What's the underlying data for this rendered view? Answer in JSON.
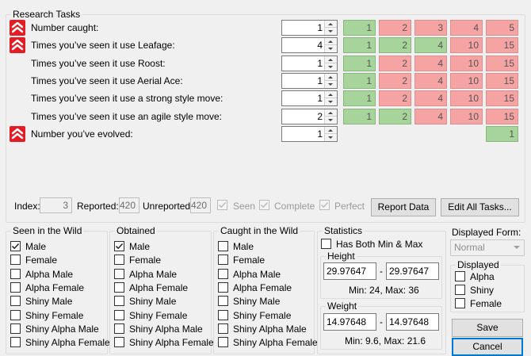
{
  "research": {
    "legend": "Research Tasks",
    "tasks": [
      {
        "label": "Number caught:",
        "value": "1",
        "priority": true,
        "thresholds": [
          {
            "v": "1",
            "c": "g"
          },
          {
            "v": "2",
            "c": "r"
          },
          {
            "v": "3",
            "c": "r"
          },
          {
            "v": "4",
            "c": "r"
          },
          {
            "v": "5",
            "c": "r"
          }
        ]
      },
      {
        "label": "Times you’ve seen it use Leafage:",
        "value": "4",
        "priority": true,
        "thresholds": [
          {
            "v": "1",
            "c": "g"
          },
          {
            "v": "2",
            "c": "g"
          },
          {
            "v": "4",
            "c": "g"
          },
          {
            "v": "10",
            "c": "r"
          },
          {
            "v": "15",
            "c": "r"
          }
        ]
      },
      {
        "label": "Times you’ve seen it use Roost:",
        "value": "1",
        "priority": false,
        "thresholds": [
          {
            "v": "1",
            "c": "g"
          },
          {
            "v": "2",
            "c": "r"
          },
          {
            "v": "4",
            "c": "r"
          },
          {
            "v": "10",
            "c": "r"
          },
          {
            "v": "15",
            "c": "r"
          }
        ]
      },
      {
        "label": "Times you’ve seen it use Aerial Ace:",
        "value": "1",
        "priority": false,
        "thresholds": [
          {
            "v": "1",
            "c": "g"
          },
          {
            "v": "2",
            "c": "r"
          },
          {
            "v": "4",
            "c": "r"
          },
          {
            "v": "10",
            "c": "r"
          },
          {
            "v": "15",
            "c": "r"
          }
        ]
      },
      {
        "label": "Times you’ve seen it use a strong style move:",
        "value": "1",
        "priority": false,
        "thresholds": [
          {
            "v": "1",
            "c": "g"
          },
          {
            "v": "2",
            "c": "r"
          },
          {
            "v": "4",
            "c": "r"
          },
          {
            "v": "10",
            "c": "r"
          },
          {
            "v": "15",
            "c": "r"
          }
        ]
      },
      {
        "label": "Times you’ve seen it use an agile style move:",
        "value": "2",
        "priority": false,
        "thresholds": [
          {
            "v": "1",
            "c": "g"
          },
          {
            "v": "2",
            "c": "g"
          },
          {
            "v": "4",
            "c": "r"
          },
          {
            "v": "10",
            "c": "r"
          },
          {
            "v": "15",
            "c": "r"
          }
        ]
      },
      {
        "label": "Number you’ve evolved:",
        "value": "1",
        "priority": true,
        "thresholds": [
          {
            "v": "1",
            "c": "g"
          }
        ]
      }
    ],
    "index_label": "Index:",
    "index_value": "3",
    "reported_label": "Reported:",
    "reported_value": "420",
    "unreported_label": "Unreported:",
    "unreported_value": "420",
    "seen_label": "Seen",
    "complete_label": "Complete",
    "perfect_label": "Perfect",
    "report_button": "Report Data",
    "edit_all_button": "Edit All Tasks..."
  },
  "seen_in_wild": {
    "legend": "Seen in the Wild",
    "items": [
      {
        "label": "Male",
        "checked": true
      },
      {
        "label": "Female",
        "checked": false
      },
      {
        "label": "Alpha Male",
        "checked": false
      },
      {
        "label": "Alpha Female",
        "checked": false
      },
      {
        "label": "Shiny Male",
        "checked": false
      },
      {
        "label": "Shiny Female",
        "checked": false
      },
      {
        "label": "Shiny Alpha Male",
        "checked": false
      },
      {
        "label": "Shiny Alpha Female",
        "checked": false
      }
    ]
  },
  "obtained": {
    "legend": "Obtained",
    "items": [
      {
        "label": "Male",
        "checked": true
      },
      {
        "label": "Female",
        "checked": false
      },
      {
        "label": "Alpha Male",
        "checked": false
      },
      {
        "label": "Alpha Female",
        "checked": false
      },
      {
        "label": "Shiny Male",
        "checked": false
      },
      {
        "label": "Shiny Female",
        "checked": false
      },
      {
        "label": "Shiny Alpha Male",
        "checked": false
      },
      {
        "label": "Shiny Alpha Female",
        "checked": false
      }
    ]
  },
  "caught_in_wild": {
    "legend": "Caught in the Wild",
    "items": [
      {
        "label": "Male",
        "checked": false
      },
      {
        "label": "Female",
        "checked": false
      },
      {
        "label": "Alpha Male",
        "checked": false
      },
      {
        "label": "Alpha Female",
        "checked": false
      },
      {
        "label": "Shiny Male",
        "checked": false
      },
      {
        "label": "Shiny Female",
        "checked": false
      },
      {
        "label": "Shiny Alpha Male",
        "checked": false
      },
      {
        "label": "Shiny Alpha Female",
        "checked": false
      }
    ]
  },
  "statistics": {
    "legend": "Statistics",
    "has_both_label": "Has Both Min & Max",
    "height": {
      "legend": "Height",
      "min": "29.97647",
      "dash": "-",
      "max": "29.97647",
      "summary": "Min: 24, Max: 36"
    },
    "weight": {
      "legend": "Weight",
      "min": "14.97648",
      "dash": "-",
      "max": "14.97648",
      "summary": "Min: 9.6, Max: 21.6"
    }
  },
  "form": {
    "label": "Displayed Form:",
    "selected": "Normal",
    "displayed_legend": "Displayed",
    "displayed_items": [
      {
        "label": "Alpha",
        "checked": false
      },
      {
        "label": "Shiny",
        "checked": false
      },
      {
        "label": "Female",
        "checked": false
      }
    ],
    "save_button": "Save",
    "cancel_button": "Cancel"
  },
  "colors": {
    "green_cell": "#a6d49b",
    "red_cell": "#f6a3a3",
    "priority_icon": "#e51c23",
    "default_button_border": "#0078d7"
  }
}
